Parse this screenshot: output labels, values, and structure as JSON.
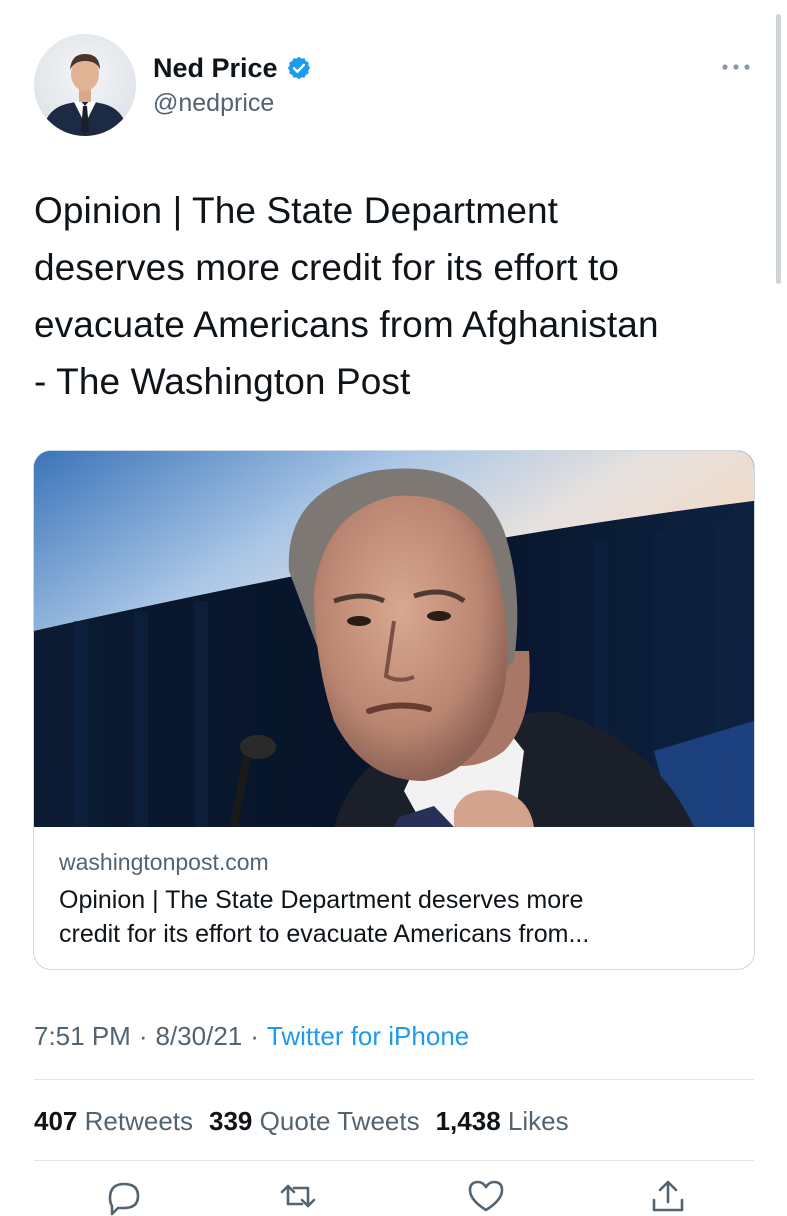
{
  "author": {
    "name": "Ned Price",
    "handle": "@nedprice",
    "verified": true,
    "avatar": "avatar-photo"
  },
  "more_icon": "more-horizontal-icon",
  "tweet": {
    "lines": [
      "Opinion | The State Department",
      "deserves more credit for its effort to",
      "evacuate Americans from Afghanistan",
      "- The Washington Post"
    ]
  },
  "link_card": {
    "image": "card-photo",
    "domain": "washingtonpost.com",
    "title_lines": [
      "Opinion | The State Department deserves more",
      "credit for its effort to evacuate Americans from..."
    ]
  },
  "meta": {
    "time": "7:51 PM",
    "date": "8/30/21",
    "separator": "·",
    "source": "Twitter for iPhone"
  },
  "stats": {
    "retweets": {
      "count": "407",
      "label": "Retweets"
    },
    "quote_tweets": {
      "count": "339",
      "label": "Quote Tweets"
    },
    "likes": {
      "count": "1,438",
      "label": "Likes"
    }
  },
  "actions": [
    "reply-icon",
    "retweet-icon",
    "like-icon",
    "share-icon"
  ],
  "colors": {
    "accent": "#1d9bf0",
    "text_primary": "#0f1419",
    "text_secondary": "#536471",
    "border": "#cfd9de"
  }
}
